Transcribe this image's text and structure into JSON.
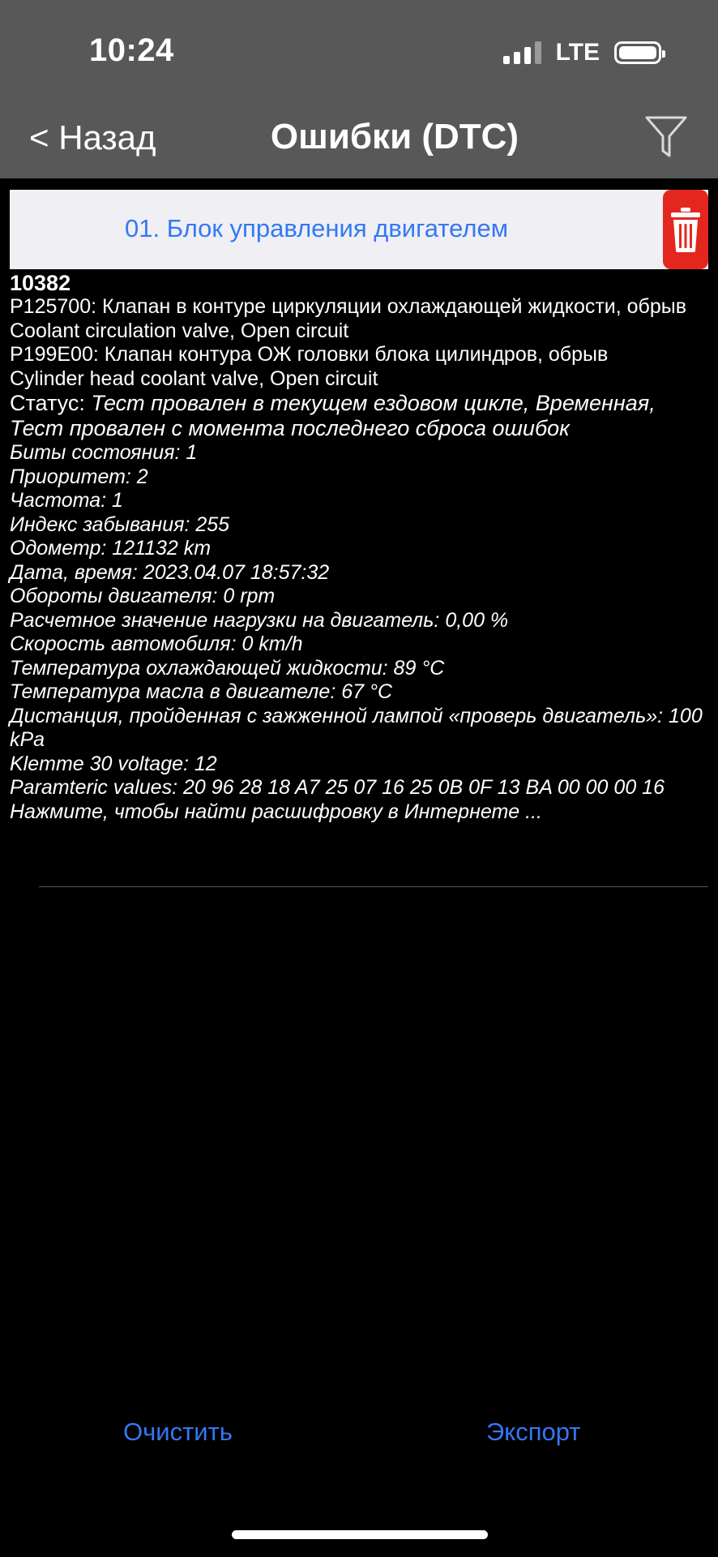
{
  "status_bar": {
    "time": "10:24",
    "network": "LTE"
  },
  "nav": {
    "back_label": "< Назад",
    "title": "Ошибки (DTC)",
    "filter_icon": "filter-funnel-icon"
  },
  "section": {
    "title": "01. Блок управления двигателем",
    "delete_icon": "trash-icon"
  },
  "dtc": {
    "code": "10382",
    "lines": [
      "P125700: Клапан в контуре циркуляции охлаждающей жидкости, обрыв",
      "Coolant circulation valve, Open circuit",
      "P199E00: Клапан контура ОЖ головки блока цилиндров, обрыв",
      "Cylinder head coolant valve, Open circuit"
    ],
    "status_label": "Статус: ",
    "status_value": "Тест провален в текущем ездовом цикле, Временная, Тест провален с момента последнего сброса ошибок",
    "details": [
      "Биты состояния: 1",
      "Приоритет: 2",
      "Частота: 1",
      "Индекс забывания: 255",
      "Одометр: 121132 km",
      "Дата, время: 2023.04.07 18:57:32",
      "Обороты двигателя: 0 rpm",
      "Расчетное значение нагрузки на двигатель: 0,00 %",
      "Скорость автомобиля: 0 km/h",
      "Температура охлаждающей жидкости: 89 °C",
      "Температура масла в двигателе: 67 °C",
      "Дистанция, пройденная с зажженной лампой «проверь двигатель»: 100 kPa",
      "Klemme 30 voltage: 12",
      "Paramteric values:  20 96 28 18 A7 25 07 16 25 0B 0F 13 BA 00 00 00 16",
      "Нажмите, чтобы найти расшифровку в Интернете ..."
    ]
  },
  "bottom": {
    "clear_label": "Очистить",
    "export_label": "Экспорт"
  },
  "colors": {
    "accent": "#3478f6",
    "delete": "#e3271f",
    "nav_bg": "#585858",
    "section_bg": "#efeff4"
  }
}
